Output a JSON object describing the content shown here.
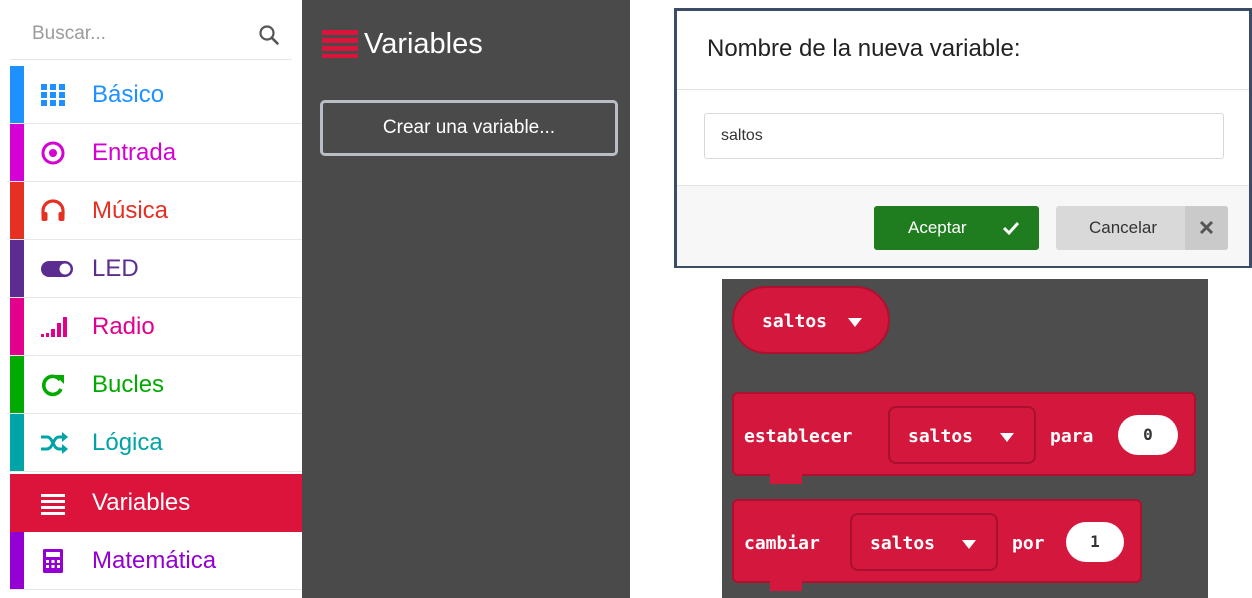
{
  "search": {
    "placeholder": "Buscar..."
  },
  "categories": [
    {
      "label": "Básico",
      "color": "#1e90ff",
      "icon": "grid-icon"
    },
    {
      "label": "Entrada",
      "color": "#d400d4",
      "icon": "target-icon"
    },
    {
      "label": "Música",
      "color": "#e63022",
      "icon": "headphones-icon"
    },
    {
      "label": "LED",
      "color": "#5c2d91",
      "icon": "toggle-icon"
    },
    {
      "label": "Radio",
      "color": "#e3008c",
      "icon": "signal-bars-icon"
    },
    {
      "label": "Bucles",
      "color": "#00aa00",
      "icon": "loop-arrow-icon"
    },
    {
      "label": "Lógica",
      "color": "#00a4a6",
      "icon": "shuffle-icon"
    },
    {
      "label": "Variables",
      "color": "#dc143c",
      "icon": "lines-icon",
      "selected": true
    },
    {
      "label": "Matemática",
      "color": "#9400d3",
      "icon": "calculator-icon"
    }
  ],
  "flyout": {
    "title": "Variables",
    "create_button": "Crear una variable..."
  },
  "dialog": {
    "title": "Nombre de la nueva variable:",
    "input_value": "saltos",
    "accept_label": "Aceptar",
    "cancel_label": "Cancelar"
  },
  "blocks": {
    "variable_name": "saltos",
    "set_block": {
      "keyword": "establecer",
      "variable": "saltos",
      "connector": "para",
      "value": "0"
    },
    "change_block": {
      "keyword": "cambiar",
      "variable": "saltos",
      "connector": "por",
      "value": "1"
    }
  }
}
